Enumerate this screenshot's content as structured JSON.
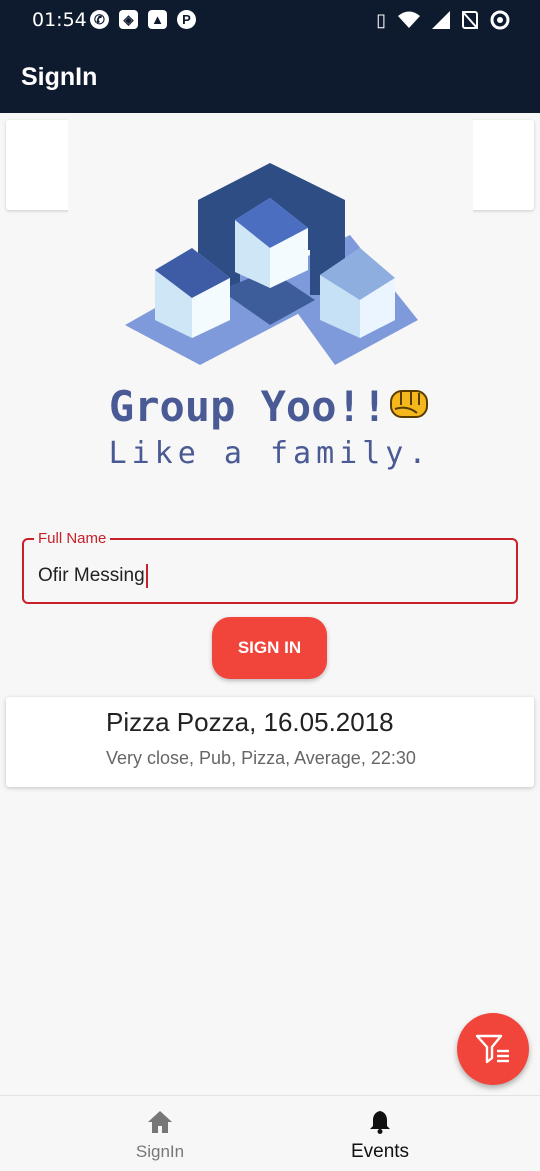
{
  "status_bar": {
    "time": "01:54",
    "left_icons": [
      "whatsapp-icon",
      "maps-icon",
      "image-icon",
      "parking-icon"
    ],
    "right_icons": [
      "vibrate-icon",
      "wifi-icon",
      "signal-icon",
      "no-sim-icon",
      "data-saver-icon"
    ]
  },
  "app_bar": {
    "title": "SignIn"
  },
  "logo": {
    "brand": "Group Yoo!!",
    "tagline": "Like a family.",
    "brand_color": "#4a5a94"
  },
  "form": {
    "name_label": "Full Name",
    "name_value": "Ofir Messing",
    "signin_label": "SIGN IN",
    "accent_color": "#f1453b"
  },
  "events": [
    {
      "title": "Pizza Pozza, 16.05.2018",
      "details": "Very close, Pub, Pizza, Average, 22:30"
    }
  ],
  "fab": {
    "icon": "filter-list-icon"
  },
  "bottom_nav": [
    {
      "label": "SignIn",
      "icon": "home-icon",
      "active": false
    },
    {
      "label": "Events",
      "icon": "bell-icon",
      "active": true
    }
  ],
  "colors": {
    "primary_dark": "#0e1a2e",
    "background": "#f7f7f7"
  }
}
